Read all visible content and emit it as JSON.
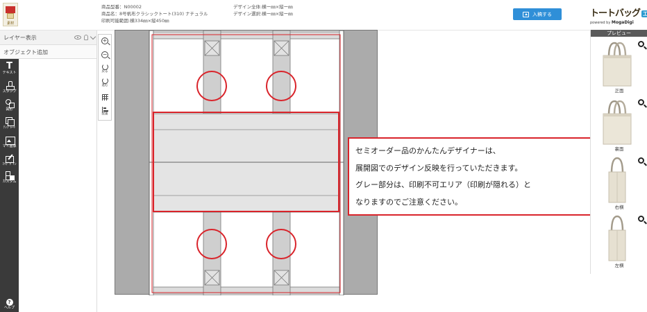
{
  "header": {
    "logo_text": "素材",
    "product_code": "商品型番：N00002",
    "product_name": "商品名：8号帆布クラシックトート(310) ナチュラル",
    "print_area": "印刷可能範囲:横334㎜×縦450㎜",
    "design_total": "デザイン全体:横ー㎜×縦ー㎜",
    "design_selected": "デザイン選択:横ー㎜×縦ー㎜",
    "upload_button": "入稿する",
    "brand_main": "トートバッグ",
    "brand_badge": "工房",
    "brand_powered": "powered by",
    "brand_company": "MogaDigi"
  },
  "left_panel": {
    "layer_label": "レイヤー表示",
    "object_label": "オブジェクト追加",
    "tools": [
      {
        "label": "テキスト",
        "icon": "text-icon"
      },
      {
        "label": "スタンプ",
        "icon": "stamp-icon"
      },
      {
        "label": "図形",
        "icon": "shape-icon"
      },
      {
        "label": "ﾃﾝﾌﾟﾚｰﾄ",
        "icon": "template-icon"
      },
      {
        "label": "マイ画像",
        "icon": "image-icon"
      },
      {
        "label": "ﾏｲﾃﾞｻﾞｲﾝ",
        "icon": "my-design-icon"
      },
      {
        "label": "カスタム",
        "icon": "custom-icon"
      }
    ],
    "help_label": "ヘルプ"
  },
  "zoom_tools": {
    "undo_label": "戻る",
    "redo_label": "進む",
    "align_label": "配置"
  },
  "notice": {
    "lines": [
      "セミオーダー品のかんたんデザイナーは、",
      "展開図でのデザイン反映を行っていただきます。",
      "グレー部分は、印刷不可エリア（印刷が隠れる）と",
      "なりますのでご注意ください。"
    ],
    "border_color": "#d9232a"
  },
  "preview": {
    "title": "プレビュー",
    "items": [
      {
        "label": "正面"
      },
      {
        "label": "裏面"
      },
      {
        "label": "右横"
      },
      {
        "label": "左横"
      }
    ]
  },
  "colors": {
    "accent_blue": "#2f8fd8",
    "mark_red": "#d9232a",
    "toolbar_dark": "#3a3a3a"
  }
}
